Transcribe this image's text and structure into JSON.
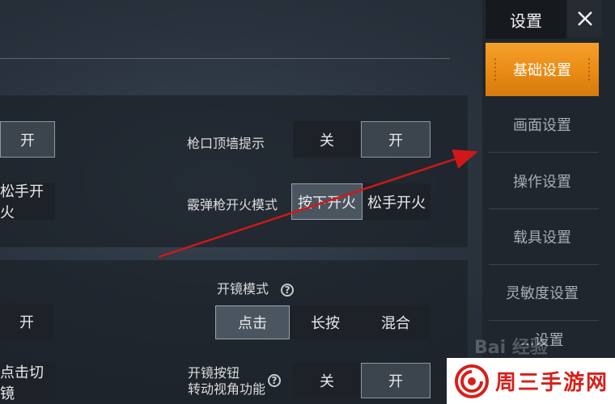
{
  "settings_title": "设置",
  "close_label": "✕",
  "menu": [
    {
      "label": "基础设置",
      "active": true
    },
    {
      "label": "画面设置",
      "active": false
    },
    {
      "label": "操作设置",
      "active": false
    },
    {
      "label": "载具设置",
      "active": false
    },
    {
      "label": "灵敏度设置",
      "active": false
    },
    {
      "label": "...设置",
      "active": false
    }
  ],
  "panel1": {
    "left_toggle_on": "开",
    "left_fire_mode": "松手开火",
    "muzzle_wall_label": "枪口顶墙提示",
    "muzzle_wall_off": "关",
    "muzzle_wall_on": "开",
    "shotgun_fire_label": "霰弹枪开火模式",
    "shotgun_press": "按下开火",
    "shotgun_release": "松手开火"
  },
  "panel2": {
    "left_toggle_on": "开",
    "left_switch_scope": "点击切镜",
    "scope_mode_label": "开镜模式",
    "help_icon": "?",
    "scope_click": "点击",
    "scope_hold": "长按",
    "scope_mix": "混合",
    "scope_btn_label_line1": "开镜按钮",
    "scope_btn_label_line2": "转动视角功能",
    "scope_btn_off": "关",
    "scope_btn_on": "开"
  },
  "watermark": "Bai 经验",
  "badge_text": "周三手游网",
  "colors": {
    "menu_active": "#f0961f",
    "badge_red": "#d6201b",
    "arrow_red": "#d01818"
  }
}
